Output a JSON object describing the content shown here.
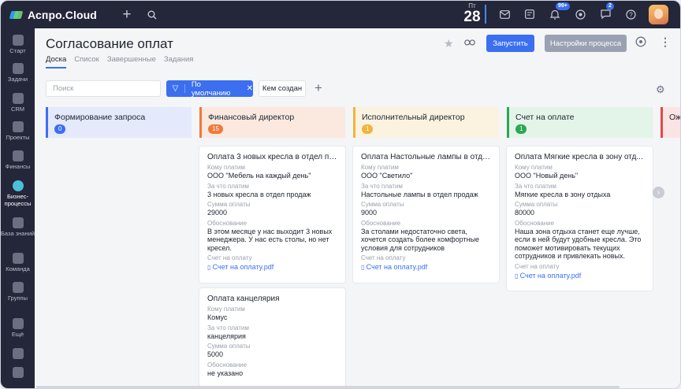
{
  "app": {
    "name": "Аспро.Cloud"
  },
  "date": {
    "dow": "Пт",
    "day": "28"
  },
  "badges": {
    "notifications": "99+",
    "messages": "2"
  },
  "sidebar": {
    "items": [
      {
        "label": "Старт"
      },
      {
        "label": "Задачи"
      },
      {
        "label": "CRM"
      },
      {
        "label": "Проекты"
      },
      {
        "label": "Финансы"
      },
      {
        "label": "Бизнес-процессы"
      },
      {
        "label": "База знаний"
      },
      {
        "label": "Команда"
      },
      {
        "label": "Группы"
      },
      {
        "label": "Ещё"
      }
    ]
  },
  "page": {
    "title": "Согласование оплат",
    "tabs": [
      "Доска",
      "Список",
      "Завершенные",
      "Задания"
    ],
    "run_label": "Запустить",
    "settings_label": "Настройки процесса"
  },
  "filters": {
    "search_placeholder": "Поиск",
    "default_label": "По умолчанию",
    "created_by_label": "Кем создан"
  },
  "columns": [
    {
      "title": "Формирование запроса",
      "count": "0",
      "color": "#3b6ff0",
      "bg": "#e4e9fb"
    },
    {
      "title": "Финансовый директор",
      "count": "15",
      "color": "#f07a3b",
      "bg": "#fbe9e0"
    },
    {
      "title": "Исполнительный директор",
      "count": "1",
      "color": "#f0b43b",
      "bg": "#fbf3e0"
    },
    {
      "title": "Счет на оплате",
      "count": "1",
      "color": "#2aa852",
      "bg": "#e3f4e8"
    },
    {
      "title": "Ож",
      "count": "",
      "color": "#e84848",
      "bg": "#fbe4e4"
    }
  ],
  "labels": {
    "whom": "Кому платим",
    "what": "За что платим",
    "sum": "Сумма оплаты",
    "reason": "Обоснование",
    "invoice": "Счет на оплату"
  },
  "cards": [
    {
      "title": "Оплата 3 новых кресла в отдел пр...",
      "whom": "ООО \"Мебель на каждый день\"",
      "what": "3 новых кресла в отдел продаж",
      "sum": "29000",
      "reason": "В этом месяце у нас выходит 3 новых менеджера. У нас есть столы, но нет кресел.",
      "file": "Счет на оплату.pdf"
    },
    {
      "title": "Оплата канцелярия",
      "whom": "Комус",
      "what": "канцелярия",
      "sum": "5000",
      "reason": "не указано",
      "file": ""
    },
    {
      "title": "Оплата Настольные лампы в отде...",
      "whom": "ООО \"Светило\"",
      "what": "Настольные лампы в отдел продаж",
      "sum": "9000",
      "reason": "За столами недостаточно света, хочется создать более комфортные условия для сотрудников",
      "file": "Счет на оплату.pdf"
    },
    {
      "title": "Оплата Мягкие кресла в зону отд...",
      "whom": "ООО \"Новый день\"",
      "what": "Мягкие кресла в зону отдыха",
      "sum": "80000",
      "reason": "Наша зона отдыха станет еще лучше, если в ней будут удобные кресла. Это поможет мотивировать текущих сотрудников и привлекать новых.",
      "file": "Счет на оплату.pdf"
    }
  ]
}
